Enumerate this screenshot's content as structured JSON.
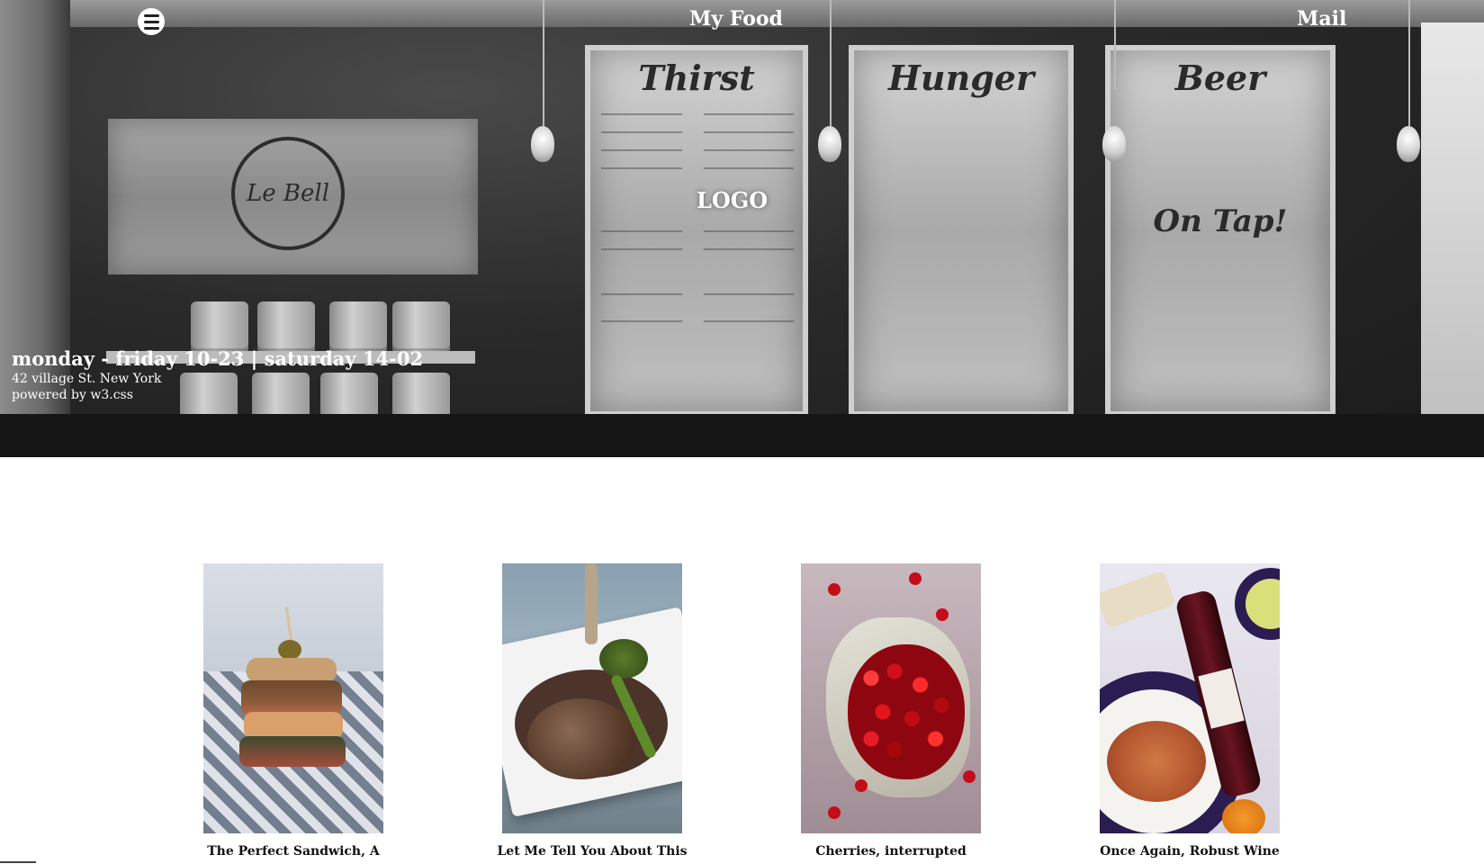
{
  "header": {
    "brand": "My Food",
    "mail_link": "Mail",
    "logo_text": "LOGO",
    "menu_icon": "hamburger-icon"
  },
  "hero": {
    "hours": "monday - friday 10-23 | saturday 14-02",
    "address": "42 village St. New York",
    "powered_by": "powered by w3.css",
    "boards": {
      "left": "Thirst",
      "middle": "Hunger",
      "right": "Beer",
      "right_sub": "On Tap!"
    }
  },
  "cards": [
    {
      "title": "The Perfect Sandwich, A",
      "image": "sandwich"
    },
    {
      "title": "Let Me Tell You About This",
      "image": "steak"
    },
    {
      "title": "Cherries, interrupted",
      "image": "cherries"
    },
    {
      "title": "Once Again, Robust Wine",
      "image": "wine-and-pasta"
    }
  ]
}
